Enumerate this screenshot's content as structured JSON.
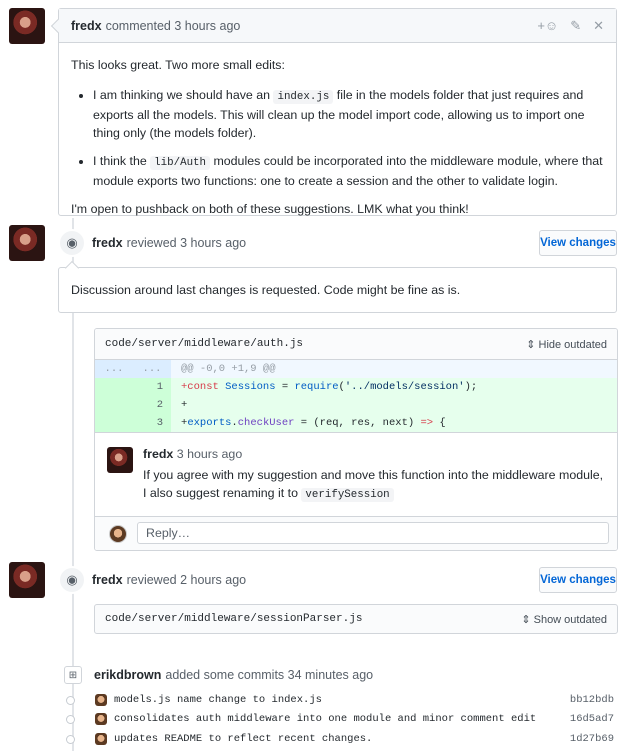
{
  "comment": {
    "author": "fredx",
    "meta": "commented 3 hours ago",
    "emoji_action": "+☺",
    "intro": "This looks great. Two more small edits:",
    "bullet1_pre": "I am thinking we should have an ",
    "bullet1_code": "index.js",
    "bullet1_post": " file in the models folder that just requires and exports all the models. This will clean up the model import code, allowing us to import one thing only (the models folder).",
    "bullet2_pre": "I think the ",
    "bullet2_code": "lib/Auth",
    "bullet2_post": " modules could be incorporated into the middleware module, where that module exports two functions: one to create a session and the other to validate login.",
    "outro": "I'm open to pushback on both of these suggestions. LMK what you think!"
  },
  "review1": {
    "author": "fredx",
    "meta": "reviewed 3 hours ago",
    "button": "View changes",
    "summary": "Discussion around last changes is requested. Code might be fine as is.",
    "file": "code/server/middleware/auth.js",
    "toggle": "Hide outdated",
    "hunk": "@@ -0,0 +1,9 @@",
    "dots": "...",
    "lines": [
      {
        "num": "1",
        "a": "+const ",
        "b": "Sessions",
        "c": " = ",
        "d": "require",
        "e": "(",
        "f": "'../models/session'",
        "g": ");"
      },
      {
        "num": "2",
        "a": "+",
        "b": "",
        "c": "",
        "d": "",
        "e": "",
        "f": "",
        "g": ""
      },
      {
        "num": "3",
        "a": "+",
        "b": "exports",
        "c": ".",
        "d": "checkUser",
        "e": " = (req, res, next) ",
        "f": "=>",
        "g": " {"
      }
    ],
    "inline": {
      "author": "fredx",
      "meta": "3 hours ago",
      "text_pre": "If you agree with my suggestion and move this function into the middleware module, I also suggest renaming it to ",
      "text_code": "verifySession"
    },
    "reply_placeholder": "Reply…"
  },
  "review2": {
    "author": "fredx",
    "meta": "reviewed 2 hours ago",
    "button": "View changes",
    "file": "code/server/middleware/sessionParser.js",
    "toggle": "Show outdated"
  },
  "commits": {
    "author": "erikdbrown",
    "meta": "added some commits 34 minutes ago",
    "items": [
      {
        "msg": "models.js name change to index.js",
        "sha": "bb12bdb"
      },
      {
        "msg": "consolidates auth middleware into one module and minor comment edit",
        "sha": "16d5ad7"
      },
      {
        "msg": "updates README to reflect recent changes.",
        "sha": "1d27b69"
      }
    ]
  }
}
